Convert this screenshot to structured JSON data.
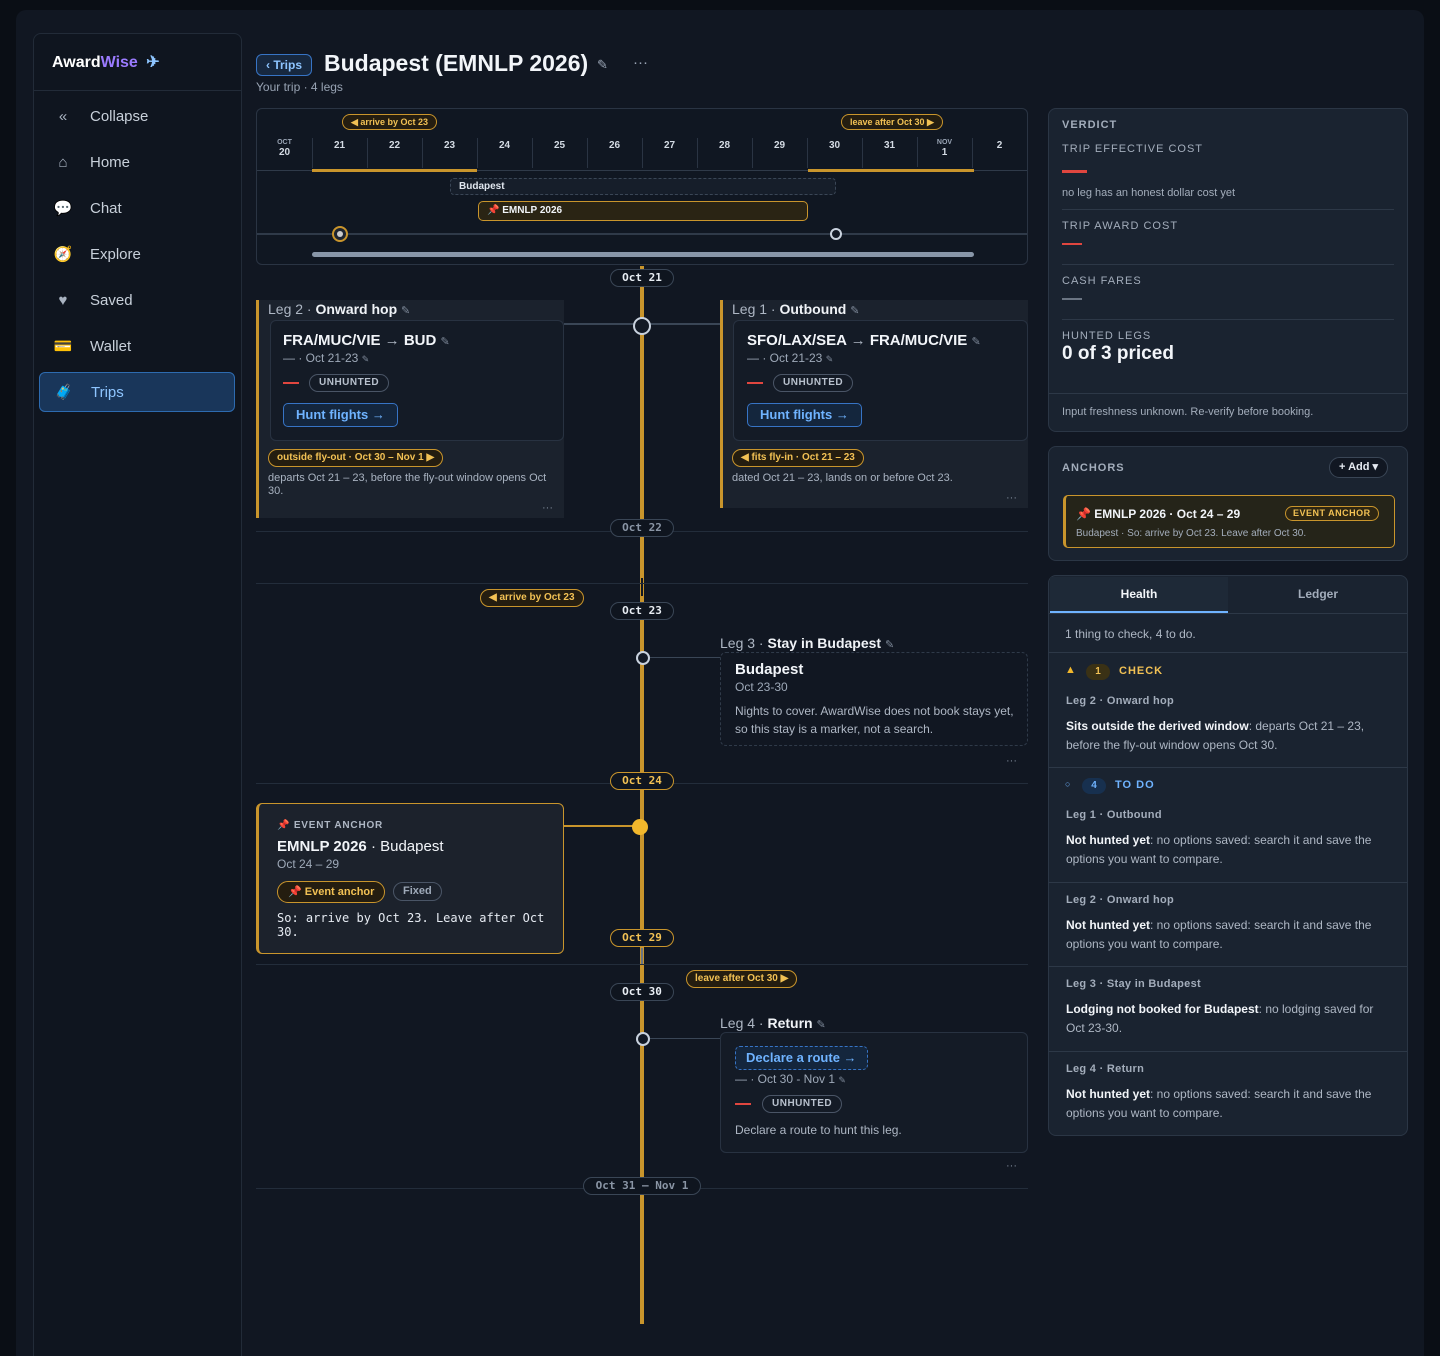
{
  "app": {
    "logo_a": "Award",
    "logo_b": "Wise"
  },
  "sidebar": {
    "items": [
      {
        "label": "Collapse",
        "icon": "chevrons-left-icon"
      },
      {
        "label": "Home",
        "icon": "home-icon"
      },
      {
        "label": "Chat",
        "icon": "chat-bubble-icon"
      },
      {
        "label": "Explore",
        "icon": "compass-icon"
      },
      {
        "label": "Saved",
        "icon": "heart-icon"
      },
      {
        "label": "Wallet",
        "icon": "credit-card-icon"
      },
      {
        "label": "Trips",
        "icon": "suitcase-icon",
        "active": true
      }
    ]
  },
  "header": {
    "back": "‹ Trips",
    "title": "Budapest (EMNLP 2026)",
    "subtitle": "Your trip · 4 legs",
    "more": "···"
  },
  "calendar": {
    "tag_arrive": "◀ arrive by Oct 23",
    "tag_leave": "leave after Oct 30 ▶",
    "days": [
      {
        "m": "OCT",
        "d": "20"
      },
      {
        "m": "",
        "d": "21"
      },
      {
        "m": "",
        "d": "22"
      },
      {
        "m": "",
        "d": "23"
      },
      {
        "m": "",
        "d": "24"
      },
      {
        "m": "",
        "d": "25"
      },
      {
        "m": "",
        "d": "26"
      },
      {
        "m": "",
        "d": "27"
      },
      {
        "m": "",
        "d": "28"
      },
      {
        "m": "",
        "d": "29"
      },
      {
        "m": "",
        "d": "30"
      },
      {
        "m": "",
        "d": "31"
      },
      {
        "m": "NOV",
        "d": "1"
      },
      {
        "m": "",
        "d": "2"
      }
    ],
    "stay_label": "Budapest",
    "event_label": "📌 EMNLP 2026"
  },
  "timeline": {
    "dates": [
      "Oct 21",
      "Oct 22",
      "Oct 23",
      "Oct 24",
      "Oct 29",
      "Oct 30",
      "Oct 31 – Nov 1"
    ],
    "tag_arrive": "◀ arrive by Oct 23",
    "tag_leave": "leave after Oct 30 ▶"
  },
  "legs": {
    "leg2": {
      "num": "Leg 2 ·",
      "name": "Onward hop",
      "from": "FRA/MUC/VIE",
      "to": "BUD",
      "dates": "— · Oct 21-23",
      "status": "UNHUNTED",
      "cta": "Hunt flights →",
      "flag": "outside fly-out · Oct 30 – Nov 1 ▶",
      "note": "departs Oct 21 – 23, before the fly-out window opens Oct 30."
    },
    "leg1": {
      "num": "Leg 1 ·",
      "name": "Outbound",
      "from": "SFO/LAX/SEA",
      "to": "FRA/MUC/VIE",
      "dates": "— · Oct 21-23",
      "status": "UNHUNTED",
      "cta": "Hunt flights →",
      "flag": "◀ fits fly-in · Oct 21 – 23",
      "note": "dated Oct 21 – 23, lands on or before Oct 23."
    },
    "leg3": {
      "num": "Leg 3 ·",
      "name": "Stay in Budapest",
      "city": "Budapest",
      "dates": "Oct 23-30",
      "note": "Nights to cover. AwardWise does not book stays yet, so this stay is a marker, not a search."
    },
    "event": {
      "cap": "📌 EVENT ANCHOR",
      "name": "EMNLP 2026",
      "city": "· Budapest",
      "dates": "Oct 24 – 29",
      "badge_anchor": "📌 Event anchor",
      "badge_fixed": "Fixed",
      "note": "So: arrive by Oct 23. Leave after Oct 30."
    },
    "leg4": {
      "num": "Leg 4 ·",
      "name": "Return",
      "cta": "Declare a route →",
      "dates": "— · Oct 30 - Nov 1",
      "status": "UNHUNTED",
      "note": "Declare a route to hunt this leg."
    }
  },
  "verdict": {
    "cap": "VERDICT",
    "effective_label": "TRIP EFFECTIVE COST",
    "effective_note": "no leg has an honest dollar cost yet",
    "award_label": "TRIP AWARD COST",
    "cash_label": "CASH FARES",
    "hunted_label": "HUNTED LEGS",
    "hunted_value": "0 of 3 priced",
    "freshness": "Input freshness unknown. Re-verify before booking."
  },
  "anchors": {
    "cap": "ANCHORS",
    "add": "+ Add ▾",
    "title": "📌 EMNLP 2026 · Oct 24 – 29",
    "badge": "EVENT ANCHOR",
    "sub": "Budapest · So: arrive by Oct 23. Leave after Oct 30."
  },
  "health": {
    "tabs": [
      "Health",
      "Ledger"
    ],
    "summary": "1 thing to check, 4 to do.",
    "check": {
      "count": "1",
      "label": "CHECK"
    },
    "check_item": {
      "leg": "Leg 2 · Onward hop",
      "bold": "Sits outside the derived window",
      "text": ": departs Oct 21 – 23, before the fly-out window opens Oct 30."
    },
    "todo": {
      "count": "4",
      "label": "TO DO"
    },
    "todo_items": [
      {
        "leg": "Leg 1 · Outbound",
        "bold": "Not hunted yet",
        "text": ": no options saved: search it and save the options you want to compare."
      },
      {
        "leg": "Leg 2 · Onward hop",
        "bold": "Not hunted yet",
        "text": ": no options saved: search it and save the options you want to compare."
      },
      {
        "leg": "Leg 3 · Stay in Budapest",
        "bold": "Lodging not booked for Budapest",
        "text": ": no lodging saved for Oct 23-30."
      },
      {
        "leg": "Leg 4 · Return",
        "bold": "Not hunted yet",
        "text": ": no options saved: search it and save the options you want to compare."
      }
    ]
  },
  "colors": {
    "accent_amber": "#c9952c",
    "accent_blue": "#6fb3ff",
    "danger": "#e0463f",
    "brand_purple": "#9b7bff"
  }
}
